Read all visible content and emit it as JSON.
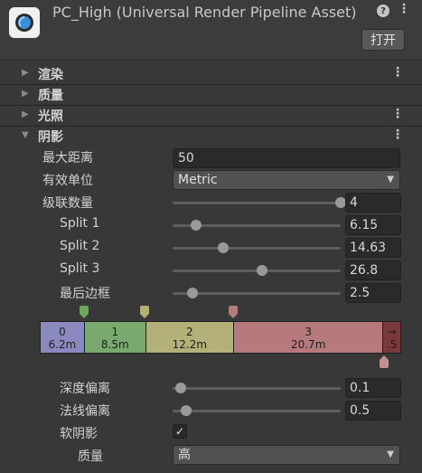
{
  "header": {
    "title": "PC_High (Universal Render Pipeline Asset)",
    "help_icon": "?",
    "menu_icon": "⋮",
    "open_button": "打开"
  },
  "sections": [
    {
      "title": "渲染",
      "expanded": false,
      "has_menu": true
    },
    {
      "title": "质量",
      "expanded": false,
      "has_menu": false
    },
    {
      "title": "光照",
      "expanded": false,
      "has_menu": true
    },
    {
      "title": "阴影",
      "expanded": true,
      "has_menu": true
    }
  ],
  "shadows": {
    "max_distance": {
      "label": "最大距离",
      "value": "50"
    },
    "working_unit": {
      "label": "有效单位",
      "value": "Metric"
    },
    "cascade_count": {
      "label": "级联数量",
      "value": "4",
      "slider_fraction": 1.0
    },
    "split1": {
      "label": "Split 1",
      "value": "6.15",
      "slider_fraction": 0.14
    },
    "split2": {
      "label": "Split 2",
      "value": "14.63",
      "slider_fraction": 0.3
    },
    "split3": {
      "label": "Split 3",
      "value": "26.8",
      "slider_fraction": 0.53
    },
    "last_border": {
      "label": "最后边框",
      "value": "2.5",
      "slider_fraction": 0.12
    },
    "cascades": [
      {
        "index": "0",
        "distance": "6.2m",
        "color": "#8a8ac0",
        "fraction": 0.123
      },
      {
        "index": "1",
        "distance": "8.5m",
        "color": "#79a96f",
        "fraction": 0.17
      },
      {
        "index": "2",
        "distance": "12.2m",
        "color": "#b3b07a",
        "fraction": 0.245
      },
      {
        "index": "3",
        "distance": "20.7m",
        "color": "#b77a7c",
        "fraction": 0.415
      },
      {
        "index": "→",
        "distance": ".5",
        "color": "#7a3a3c",
        "fraction": 0.047
      }
    ],
    "depth_bias": {
      "label": "深度偏离",
      "value": "0.1",
      "slider_fraction": 0.05
    },
    "normal_bias": {
      "label": "法线偏离",
      "value": "0.5",
      "slider_fraction": 0.08
    },
    "soft_shadows": {
      "label": "软阴影",
      "checked": true,
      "check_glyph": "✓"
    },
    "quality": {
      "label": "质量",
      "value": "高"
    }
  },
  "colors": {
    "marker1": "#6aa85a",
    "marker2": "#b5b070",
    "marker3": "#b47a7c",
    "marker_end": "#c49090"
  }
}
